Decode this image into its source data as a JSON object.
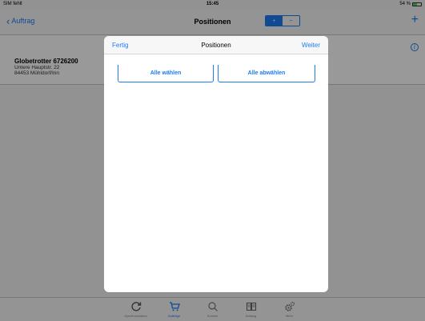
{
  "status": {
    "carrier": "SIM fehlt",
    "time": "15:45",
    "battery": "54 %",
    "battery_level": 0.54
  },
  "nav": {
    "back_label": "Auftrag",
    "title": "Positionen",
    "segment_left": "+",
    "segment_right": "−",
    "add_label": "+"
  },
  "customer": {
    "name": "Globetrotter 6726200",
    "street": "Untere Hauptstr. 22",
    "city": "84453 Mühldorf/Inn"
  },
  "modal": {
    "left_button": "Fertig",
    "title": "Positionen",
    "right_button": "Weiter",
    "select_all": "Alle wählen",
    "deselect_all": "Alle abwählen"
  },
  "tabs": [
    {
      "label": "Synchronisation",
      "icon": "sync-icon"
    },
    {
      "label": "Aufträge",
      "icon": "cart-icon"
    },
    {
      "label": "Suchen",
      "icon": "search-icon"
    },
    {
      "label": "Katalog",
      "icon": "book-icon"
    },
    {
      "label": "Mehr",
      "icon": "gear-icon"
    }
  ],
  "colors": {
    "accent": "#1a7cf5",
    "overlay": "rgba(0,0,0,0.4)"
  }
}
